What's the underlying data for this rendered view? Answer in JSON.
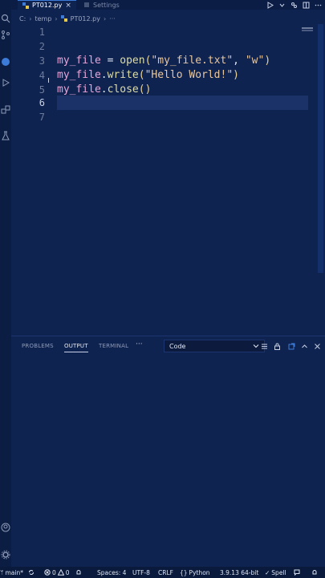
{
  "tabs": [
    {
      "label": "PT012.py",
      "active": true,
      "icon": "python-file-icon"
    },
    {
      "label": "Settings",
      "active": false,
      "icon": "settings-file-icon"
    }
  ],
  "breadcrumb": [
    "C:",
    "temp",
    "PT012.py"
  ],
  "editor": {
    "lines": [
      {
        "number": "1",
        "code": ""
      },
      {
        "number": "2",
        "code": ""
      },
      {
        "number": "3",
        "code": "my_file = open(\"my_file.txt\", \"w\")"
      },
      {
        "number": "4",
        "code": "my_file.write(\"Hello World!\")"
      },
      {
        "number": "5",
        "code": "my_file.close()"
      },
      {
        "number": "6",
        "code": ""
      },
      {
        "number": "7",
        "code": ""
      }
    ],
    "current_line": "6"
  },
  "panel": {
    "tabs": [
      "PROBLEMS",
      "OUTPUT",
      "TERMINAL"
    ],
    "active_tab": "OUTPUT",
    "more": "···",
    "channel": "Code"
  },
  "statusbar": {
    "branch": "main*",
    "errors": "0",
    "warnings": "0",
    "spaces": "Spaces: 4",
    "encoding": "UTF-8",
    "eol": "CRLF",
    "language": "Python",
    "interpreter": "3.9.13 64-bit",
    "spell": "Spell"
  },
  "colors": {
    "background": "#0f2350",
    "activity_bar": "#0c1d44",
    "keyword_variable": "#e6a6d8",
    "function": "#dcdcaa",
    "string": "#e9c79e"
  }
}
